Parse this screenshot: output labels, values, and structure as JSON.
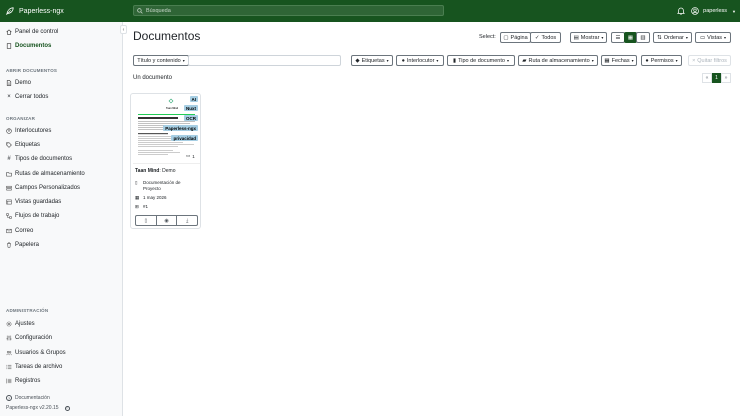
{
  "app": {
    "title": "Paperless-ngx"
  },
  "header": {
    "search_placeholder": "Búsqueda",
    "user": "paperless"
  },
  "sidebar": {
    "items_top": [
      {
        "label": "Panel de control",
        "icon": "house-icon"
      },
      {
        "label": "Documentos",
        "icon": "document-icon",
        "active": true
      }
    ],
    "open_docs_title": "ABRIR DOCUMENTOS",
    "open_docs": [
      {
        "label": "Demo",
        "icon": "file-icon"
      },
      {
        "label": "Cerrar todos",
        "icon": "close-icon"
      }
    ],
    "organize_title": "ORGANIZAR",
    "organize": [
      {
        "label": "Interlocutores",
        "icon": "person-icon"
      },
      {
        "label": "Etiquetas",
        "icon": "tag-icon"
      },
      {
        "label": "Tipos de documentos",
        "icon": "hash-icon"
      },
      {
        "label": "Rutas de almacenamiento",
        "icon": "folder-icon"
      },
      {
        "label": "Campos Personalizados",
        "icon": "fields-icon"
      },
      {
        "label": "Vistas guardadas",
        "icon": "views-icon"
      },
      {
        "label": "Flujos de trabajo",
        "icon": "workflow-icon"
      },
      {
        "label": "Correo",
        "icon": "mail-icon"
      },
      {
        "label": "Papelera",
        "icon": "trash-icon"
      }
    ],
    "admin_title": "ADMINISTRACIÓN",
    "admin": [
      {
        "label": "Ajustes",
        "icon": "gear-icon"
      },
      {
        "label": "Configuración",
        "icon": "sliders-icon"
      },
      {
        "label": "Usuarios & Grupos",
        "icon": "users-icon"
      },
      {
        "label": "Tareas de archivo",
        "icon": "list-icon"
      },
      {
        "label": "Registros",
        "icon": "log-icon"
      }
    ],
    "footer_docs": "Documentación",
    "footer_version": "Paperless-ngx v2.20.15"
  },
  "main": {
    "title": "Documentos",
    "select_label": "Select:",
    "select_page": "Página",
    "select_all": "Todos",
    "show": "Mostrar",
    "sort": "Ordenar",
    "views": "Vistas",
    "filter_mode": "Título y contenido",
    "filters": {
      "tags": "Etiquetas",
      "correspondent": "Interlocutor",
      "doc_type": "Tipo de documento",
      "storage": "Ruta de almacenamiento",
      "dates": "Fechas",
      "permissions": "Permisos",
      "clear": "Quitar filtros"
    },
    "count": "Un documento",
    "pager": {
      "prev": "«",
      "page": "1",
      "next": "»"
    }
  },
  "document": {
    "tags": [
      {
        "label": "AI",
        "bg": "#a6cee3",
        "fg": "#000000"
      },
      {
        "label": "Nuxt",
        "bg": "#a6cee3",
        "fg": "#000000"
      },
      {
        "label": "OCR",
        "bg": "#a6cee3",
        "fg": "#000000"
      },
      {
        "label": "Paperless-ngx",
        "bg": "#a6cee3",
        "fg": "#000000"
      },
      {
        "label": "privacidad",
        "bg": "#a6cee3",
        "fg": "#000000"
      }
    ],
    "notes_count": "1",
    "correspondent": "Taan Mind",
    "title_sep": ": ",
    "title": "Demo",
    "type": "Documentación de Proyecto",
    "date": "1 may 2026",
    "asn": "#1",
    "thumb_heading": "Taan Mind"
  },
  "colors": {
    "brand": "#17541f",
    "tag": "#a6cee3"
  }
}
